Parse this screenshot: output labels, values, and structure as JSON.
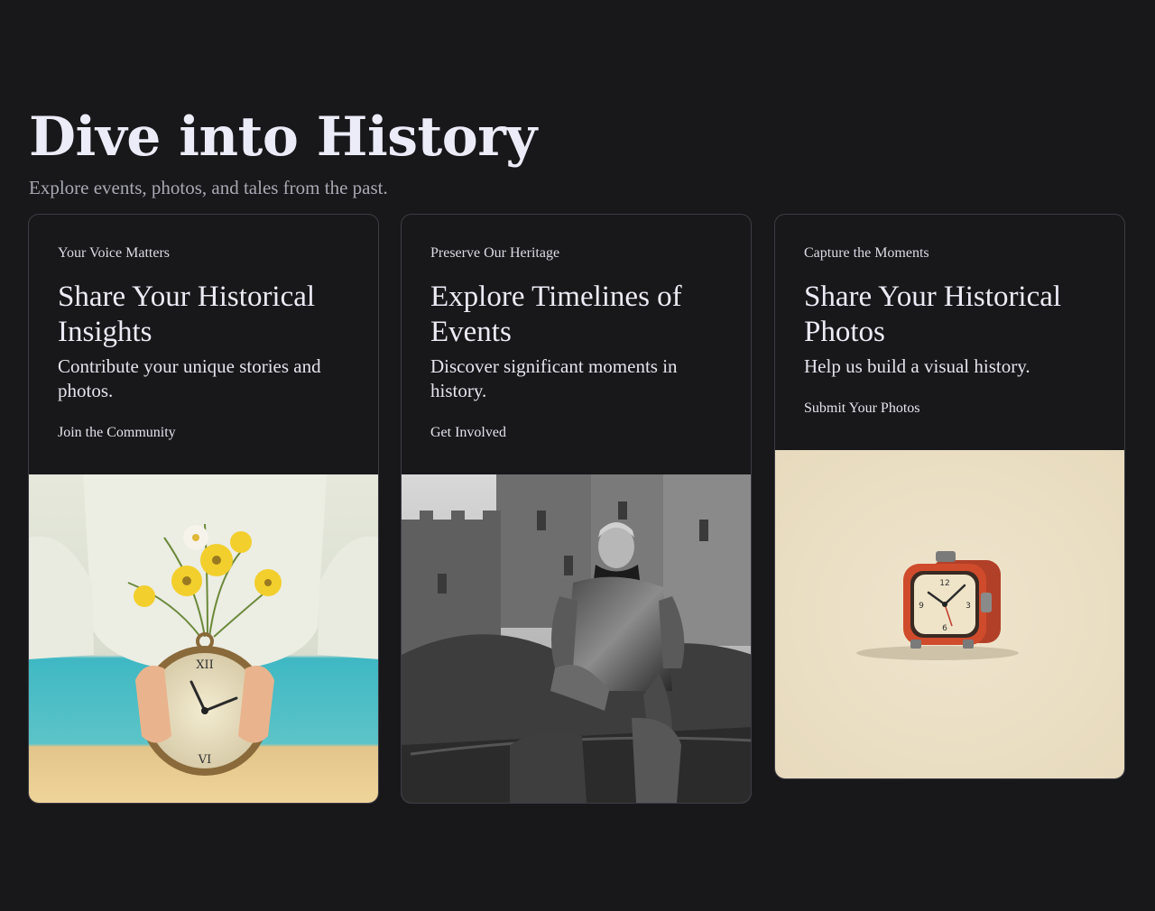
{
  "hero": {
    "title": "Dive into History",
    "subtitle": "Explore events, photos, and tales from the past."
  },
  "cards": [
    {
      "eyebrow": "Your Voice Matters",
      "title": "Share Your Historical Insights",
      "description": "Contribute your unique stories and photos.",
      "link": "Join the Community",
      "image": "pocket-watch-with-flowers-photo"
    },
    {
      "eyebrow": "Preserve Our Heritage",
      "title": "Explore Timelines of Events",
      "description": "Discover significant moments in history.",
      "link": "Get Involved",
      "image": "armored-knight-castle-photo"
    },
    {
      "eyebrow": "Capture the Moments",
      "title": "Share Your Historical Photos",
      "description": "Help us build a visual history.",
      "link": "Submit Your Photos",
      "image": "red-alarm-clock-illustration"
    }
  ],
  "colors": {
    "background": "#18181b",
    "card_border": "#3c3c44",
    "heading": "#ecebf8",
    "subtitle": "#a9a8b3"
  }
}
